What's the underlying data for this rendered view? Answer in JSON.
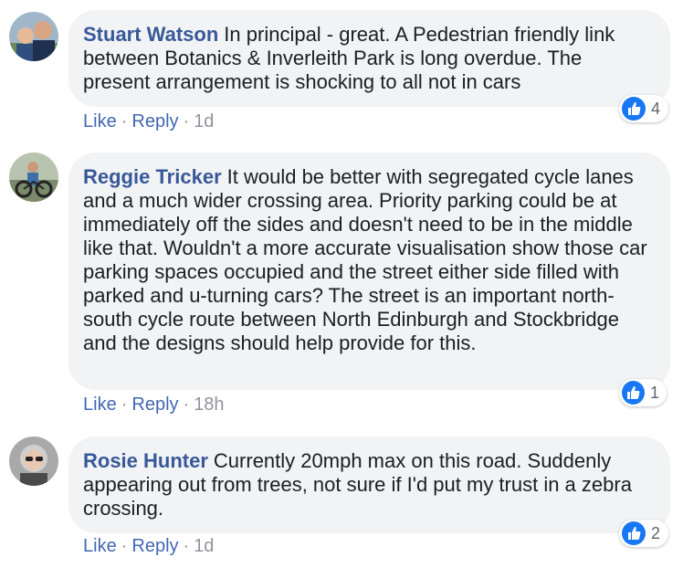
{
  "comments": [
    {
      "author": "Stuart Watson",
      "text": "In principal - great. A Pedestrian friendly link between Botanics & Inverleith Park is long overdue. The present arrangement is shocking to all not in cars",
      "like_label": "Like",
      "reply_label": "Reply",
      "separator": "·",
      "time": "1d",
      "reaction_count": "4"
    },
    {
      "author": "Reggie Tricker",
      "text": "It would be better with segregated cycle lanes and a much wider crossing area. Priority parking could be at immediately off the sides and doesn't need to be in the middle like that. Wouldn't a more accurate visualisation show those car parking spaces occupied and the street either side filled with parked and u-turning cars? The street is an important north-south cycle route between North Edinburgh and Stockbridge and the designs should help provide for this.",
      "like_label": "Like",
      "reply_label": "Reply",
      "separator": "·",
      "time": "18h",
      "reaction_count": "1"
    },
    {
      "author": "Rosie Hunter",
      "text": "Currently 20mph max on this road. Suddenly appearing out from trees, not sure if I'd put my trust in a zebra crossing.",
      "like_label": "Like",
      "reply_label": "Reply",
      "separator": "·",
      "time": "1d",
      "reaction_count": "2"
    }
  ],
  "colors": {
    "author": "#385898",
    "bubble": "#f2f3f5",
    "link": "#4267b2",
    "meta": "#90949c",
    "like_blue": "#1877f2"
  },
  "icons": [
    "avatar",
    "like-reaction-icon"
  ]
}
